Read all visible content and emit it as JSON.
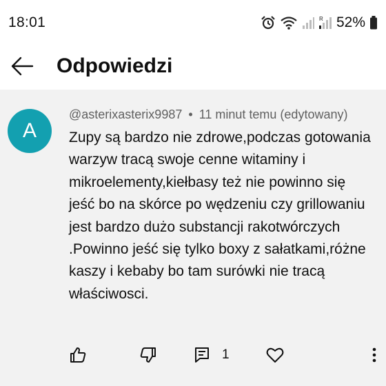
{
  "status": {
    "time": "18:01",
    "battery": "52%"
  },
  "header": {
    "title": "Odpowiedzi"
  },
  "comment": {
    "avatar_letter": "A",
    "author": "@asterixasterix9987",
    "separator": "•",
    "time": "11 minut temu (edytowany)",
    "text": "Zupy są bardzo nie zdrowe,podczas gotowania warzyw tracą swoje cenne witaminy i mikroelementy,kiełbasy też nie powinno się jeść bo na skórce po wędzeniu czy grillowaniu jest bardzo dużo substancji rakotwórczych\n.Powinno jeść się tylko boxy z sałatkami,różne kaszy i kebaby bo tam surówki nie tracą właściwosci.",
    "reply_count": "1"
  },
  "icons": {
    "back": "back-arrow-icon",
    "like": "thumbs-up-icon",
    "dislike": "thumbs-down-icon",
    "reply": "comment-icon",
    "heart": "heart-icon",
    "more": "more-vertical-icon"
  },
  "colors": {
    "avatar": "#13a0b0",
    "comment_bg": "#f2f2f2",
    "meta": "#606060"
  }
}
